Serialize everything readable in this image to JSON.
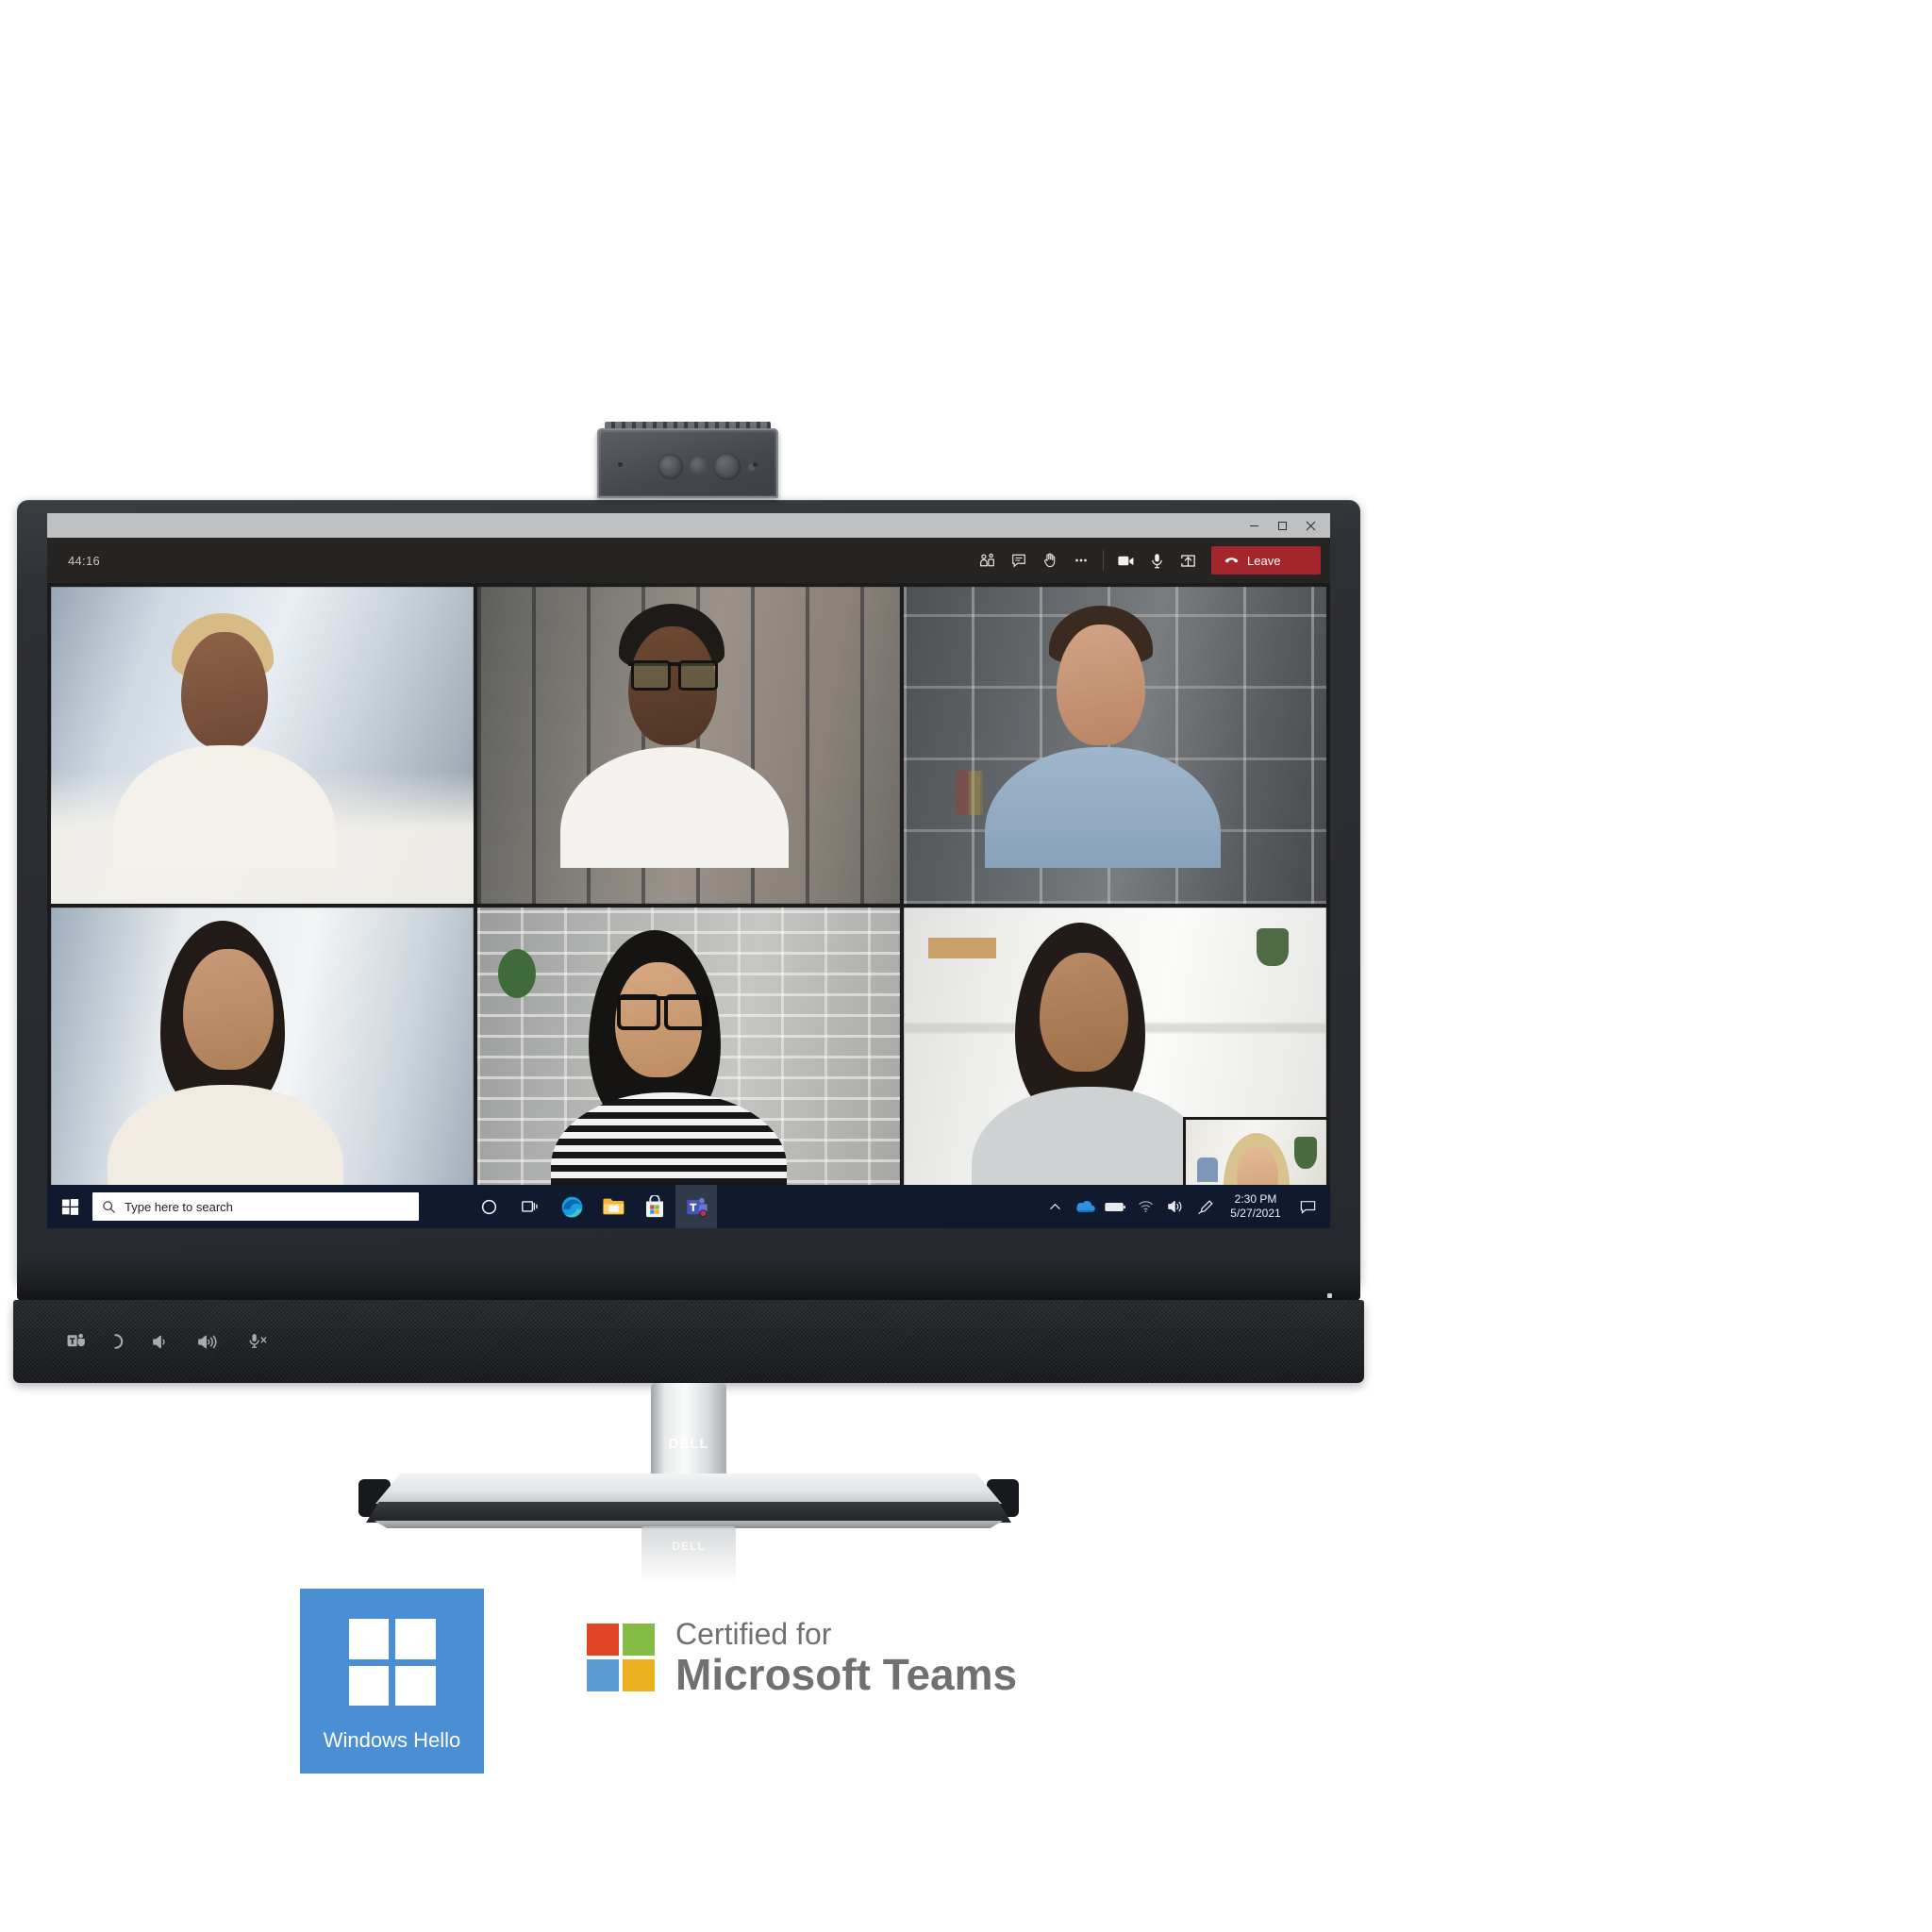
{
  "device": {
    "brand": "DELL",
    "stand_logo": "DELL",
    "reflection_logo": "DELL"
  },
  "webcam": {
    "name": "pop-up-webcam"
  },
  "window": {
    "controls": [
      {
        "name": "minimize-button",
        "glyph": "–"
      },
      {
        "name": "maximize-button",
        "glyph": "❐"
      },
      {
        "name": "close-button",
        "glyph": "✕"
      }
    ]
  },
  "teams": {
    "call_timer": "44:16",
    "toolbar": [
      {
        "name": "participants-icon",
        "label": "Show participants"
      },
      {
        "name": "chat-icon",
        "label": "Show conversation"
      },
      {
        "name": "raise-hand-icon",
        "label": "Raise hand"
      },
      {
        "name": "more-options-icon",
        "label": "More actions"
      },
      {
        "name": "camera-icon",
        "label": "Turn camera off"
      },
      {
        "name": "microphone-icon",
        "label": "Mute"
      },
      {
        "name": "share-screen-icon",
        "label": "Share content"
      }
    ],
    "leave_label": "Leave",
    "leave_color": "#a4262c",
    "participants": [
      {
        "name": "participant-tile-1",
        "description": "Woman with short blond hair in white shirt, bright office"
      },
      {
        "name": "participant-tile-2",
        "description": "Man with glasses and beard in white tee, loft interior"
      },
      {
        "name": "participant-tile-3",
        "description": "Man in denim shirt in front of bookshelves"
      },
      {
        "name": "participant-tile-4",
        "description": "Smiling woman with dark hair, light curtains"
      },
      {
        "name": "participant-tile-5",
        "description": "Woman with glasses in striped top, brick wall"
      },
      {
        "name": "participant-tile-6",
        "description": "Woman in grey top, white shelving"
      },
      {
        "name": "self-view-tile",
        "description": "Blond woman self preview, living room"
      }
    ]
  },
  "taskbar": {
    "start_label": "Start",
    "search_placeholder": "Type here to search",
    "pinned": [
      {
        "name": "cortana-icon",
        "label": "Cortana"
      },
      {
        "name": "task-view-icon",
        "label": "Task View"
      },
      {
        "name": "edge-icon",
        "label": "Microsoft Edge"
      },
      {
        "name": "file-explorer-icon",
        "label": "File Explorer"
      },
      {
        "name": "microsoft-store-icon",
        "label": "Microsoft Store"
      },
      {
        "name": "microsoft-teams-icon",
        "label": "Microsoft Teams"
      }
    ],
    "tray": [
      {
        "name": "show-hidden-icons-icon",
        "label": "Show hidden icons"
      },
      {
        "name": "onedrive-icon",
        "label": "OneDrive"
      },
      {
        "name": "battery-icon",
        "label": "Battery"
      },
      {
        "name": "network-icon",
        "label": "Network"
      },
      {
        "name": "volume-icon",
        "label": "Volume"
      },
      {
        "name": "pen-menu-icon",
        "label": "Windows Ink"
      }
    ],
    "time": "2:30 PM",
    "date": "5/27/2021",
    "action_center": {
      "name": "action-center-icon",
      "label": "Notifications"
    }
  },
  "soundbar": {
    "controls": [
      {
        "name": "teams-button",
        "label": "Teams"
      },
      {
        "name": "hook-button",
        "label": "Hook / answer call"
      },
      {
        "name": "volume-down-button",
        "label": "Volume down"
      },
      {
        "name": "volume-up-button",
        "label": "Volume up"
      },
      {
        "name": "microphone-mute-button",
        "label": "Mute microphone"
      }
    ]
  },
  "badges": {
    "windows_hello": {
      "text": "Windows Hello",
      "color": "#4a8fd4"
    },
    "certified": {
      "line1": "Certified for",
      "line2": "Microsoft Teams",
      "colors": [
        "#e04426",
        "#84bb44",
        "#5b9bd5",
        "#ecb01f"
      ]
    }
  }
}
